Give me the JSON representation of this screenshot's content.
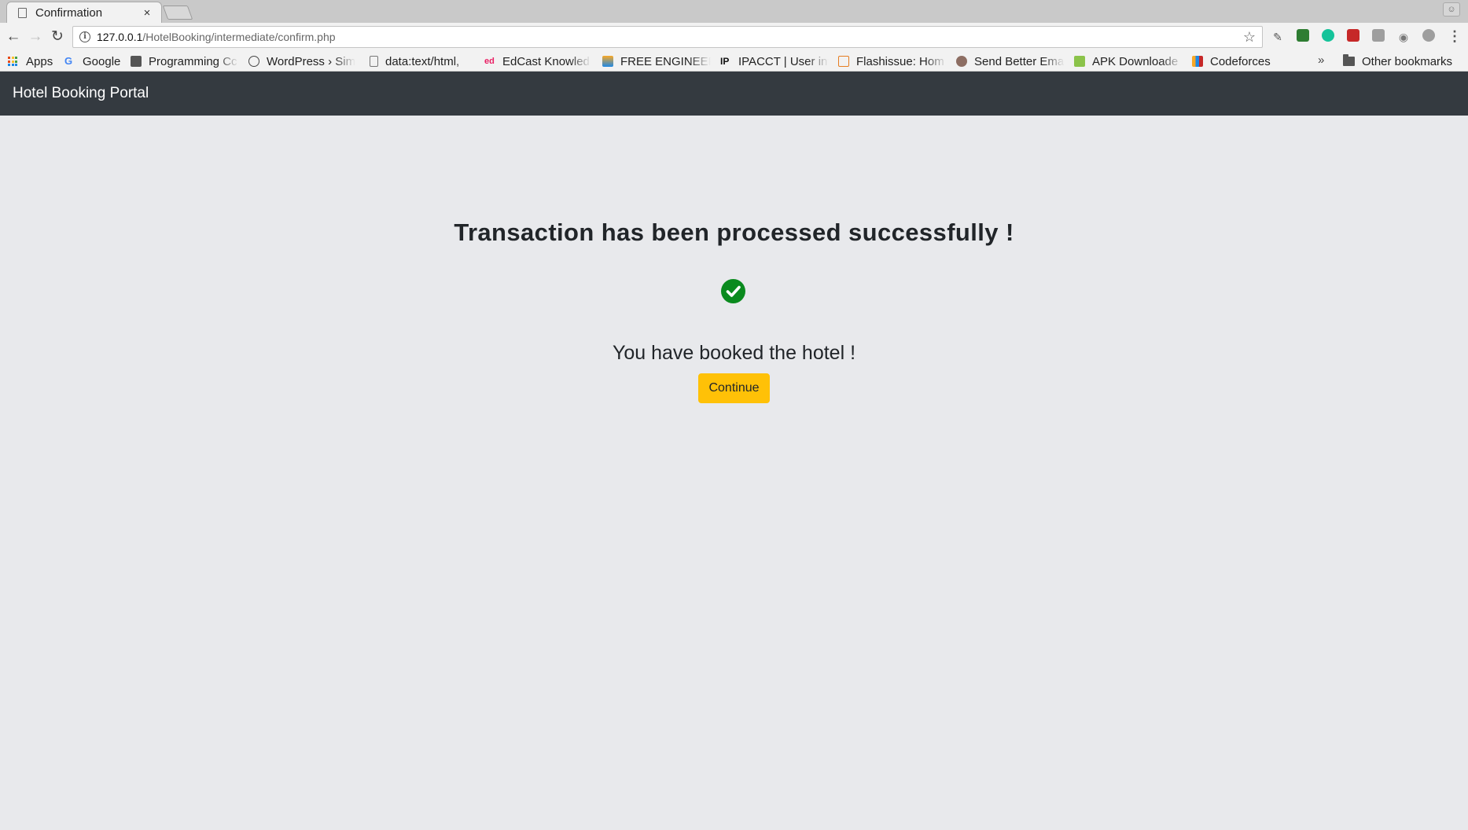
{
  "browser": {
    "tab": {
      "title": "Confirmation",
      "close_glyph": "×"
    },
    "url": {
      "host": "127.0.0.1",
      "path": "/HotelBooking/intermediate/confirm.php"
    },
    "bookmarks": [
      {
        "label": "Apps",
        "icon": "apps-grid-icon"
      },
      {
        "label": "Google",
        "icon": "google-icon",
        "color": "#4285f4"
      },
      {
        "label": "Programming Cc",
        "icon": "programming-icon",
        "color": "#555555"
      },
      {
        "label": "WordPress › Sim",
        "icon": "wordpress-icon",
        "color": "#464646"
      },
      {
        "label": "data:text/html,",
        "icon": "page-icon",
        "color": "#777777"
      },
      {
        "label": "EdCast Knowled",
        "icon": "edcast-icon",
        "color": "#e91e63"
      },
      {
        "label": "FREE ENGINEER",
        "icon": "engineering-icon",
        "color": "#f9a825"
      },
      {
        "label": "IPACCT | User inf",
        "icon": "ipacct-icon",
        "color": "#222222"
      },
      {
        "label": "Flashissue: Hom",
        "icon": "flashissue-icon",
        "color": "#e67e22"
      },
      {
        "label": "Send Better Ema",
        "icon": "email-icon",
        "color": "#8d6e63"
      },
      {
        "label": "APK Downloade",
        "icon": "apk-icon",
        "color": "#8bc34a"
      },
      {
        "label": "Codeforces",
        "icon": "codeforces-icon",
        "color": "#1e88e5"
      }
    ],
    "more_glyph": "»",
    "other_bookmarks": "Other bookmarks"
  },
  "navbar": {
    "brand": "Hotel Booking Portal"
  },
  "content": {
    "heading": "Transaction has been processed successfully !",
    "message": "You have booked the hotel !",
    "continue_label": "Continue",
    "success_color": "#0a8a1e",
    "button_color": "#ffc107"
  }
}
